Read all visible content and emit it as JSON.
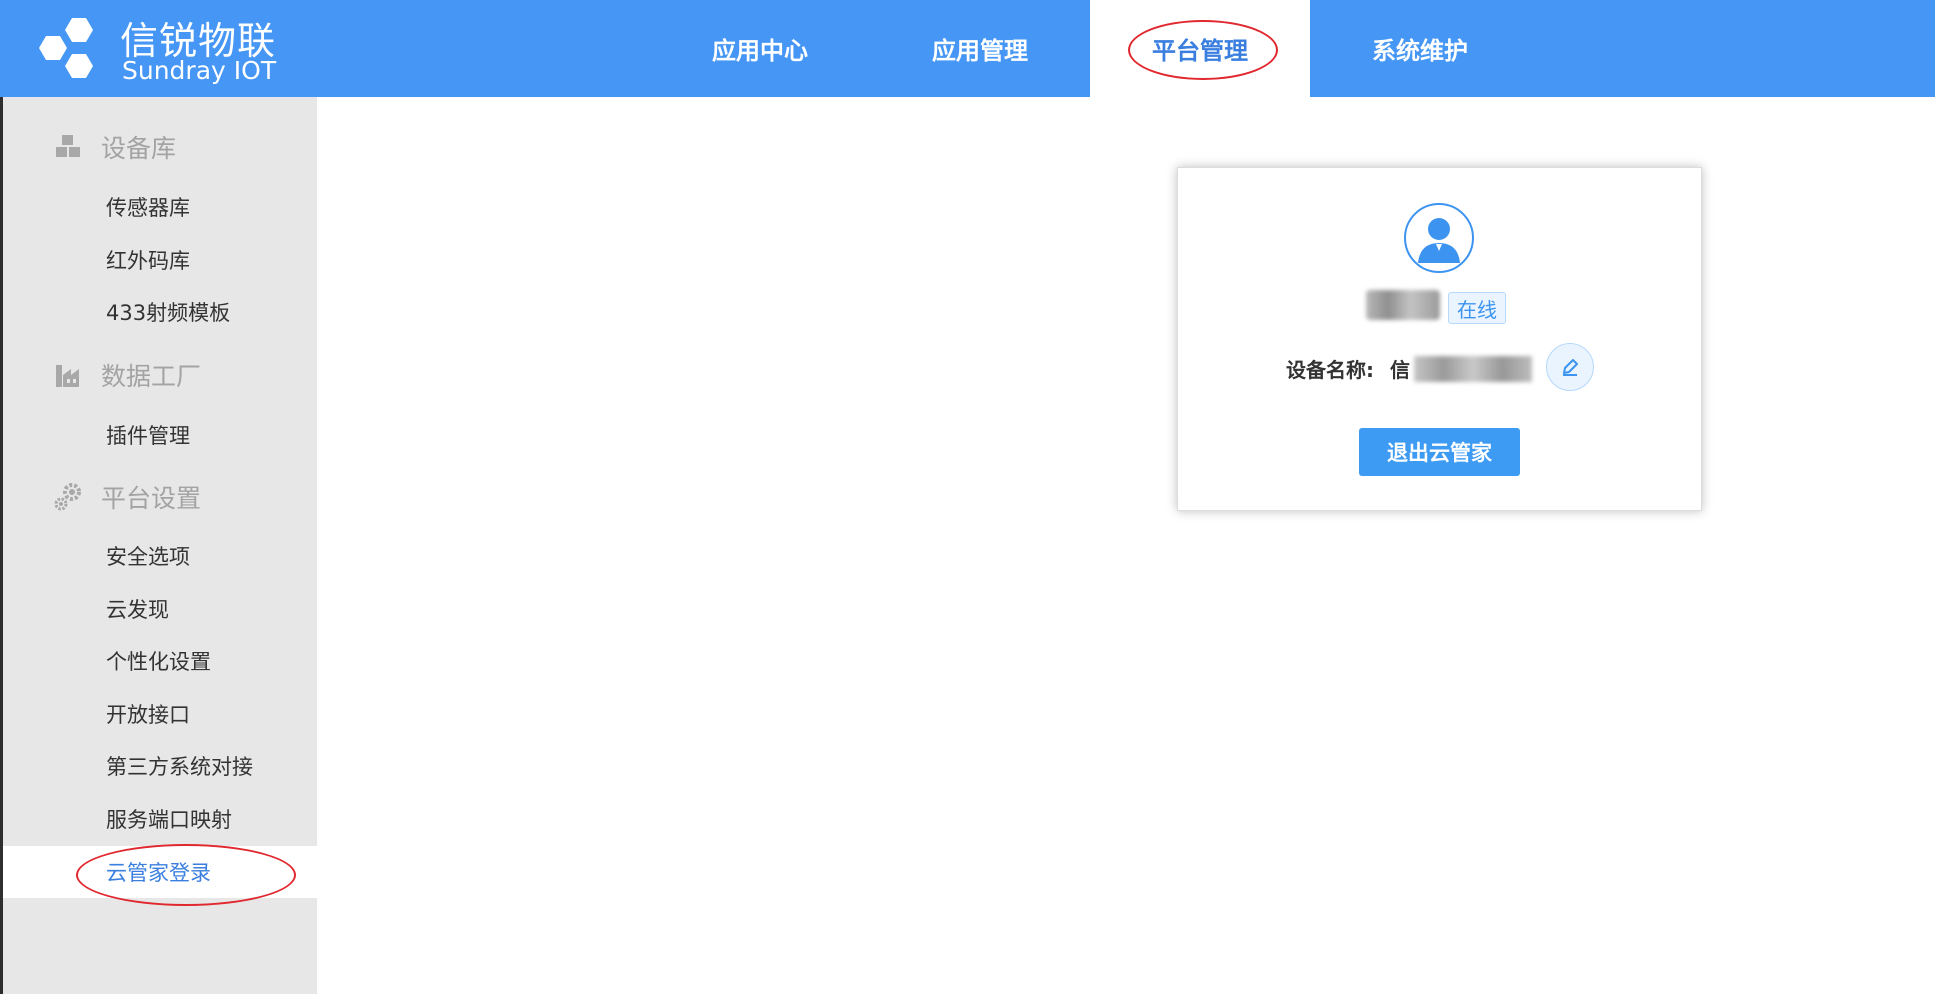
{
  "brand": {
    "name_cn": "信锐物联",
    "name_en": "Sundray IOT"
  },
  "nav": {
    "tabs": [
      {
        "label": "应用中心"
      },
      {
        "label": "应用管理"
      },
      {
        "label": "平台管理",
        "active": true
      },
      {
        "label": "系统维护"
      }
    ]
  },
  "sidebar": {
    "groups": [
      {
        "title": "设备库",
        "icon": "cubes-icon",
        "items": [
          {
            "label": "传感器库"
          },
          {
            "label": "红外码库"
          },
          {
            "label": "433射频模板"
          }
        ]
      },
      {
        "title": "数据工厂",
        "icon": "factory-icon",
        "items": [
          {
            "label": "插件管理"
          }
        ]
      },
      {
        "title": "平台设置",
        "icon": "gears-icon",
        "items": [
          {
            "label": "安全选项"
          },
          {
            "label": "云发现"
          },
          {
            "label": "个性化设置"
          },
          {
            "label": "开放接口"
          },
          {
            "label": "第三方系统对接"
          },
          {
            "label": "服务端口映射"
          },
          {
            "label": "云管家登录",
            "active": true
          }
        ]
      }
    ]
  },
  "card": {
    "status": "在线",
    "device_label": "设备名称:",
    "device_value_prefix": "信",
    "logout_label": "退出云管家"
  },
  "colors": {
    "header_bg": "#4596f5",
    "accent": "#3d94f0",
    "sidebar_bg": "#e7e7e7",
    "annotation": "#e0282e"
  }
}
